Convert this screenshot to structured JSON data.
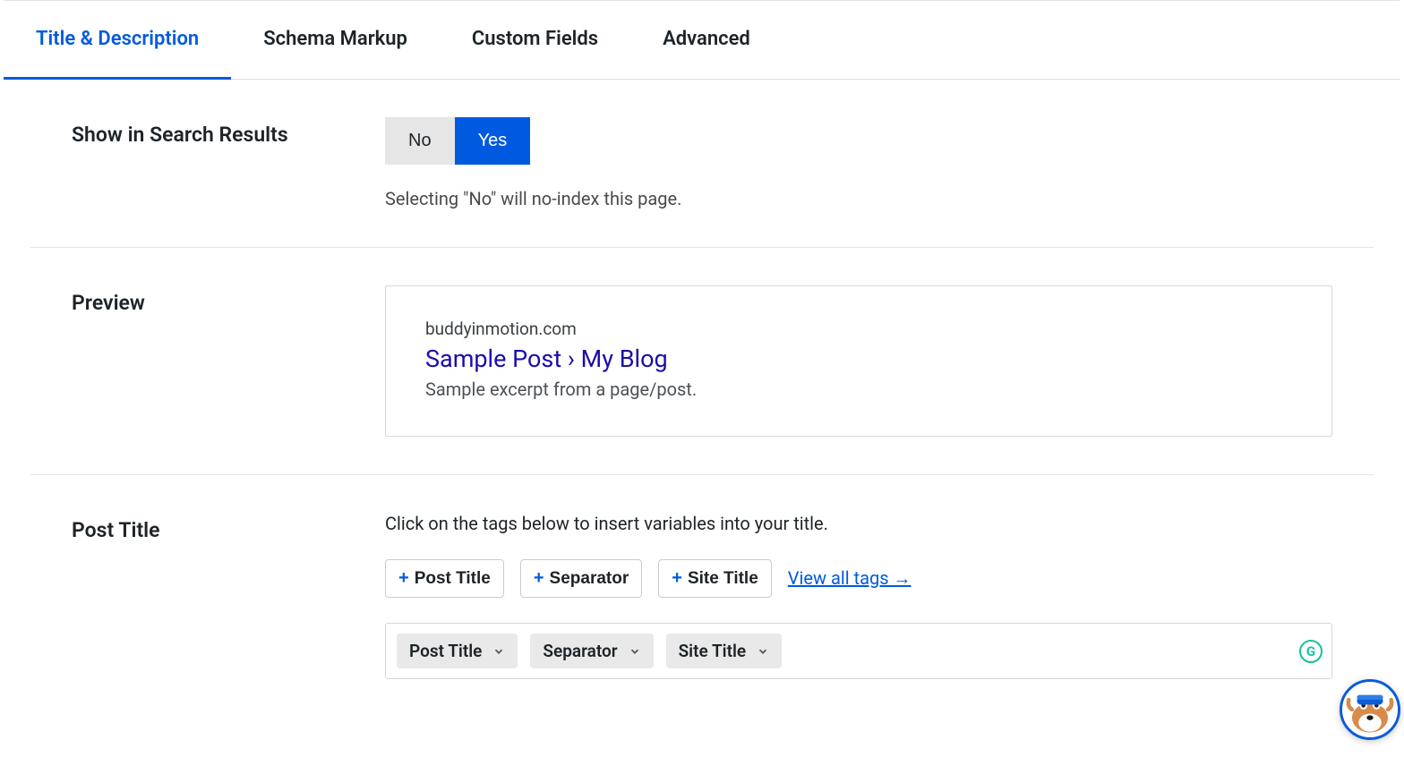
{
  "tabs": [
    {
      "label": "Title & Description",
      "active": true
    },
    {
      "label": "Schema Markup",
      "active": false
    },
    {
      "label": "Custom Fields",
      "active": false
    },
    {
      "label": "Advanced",
      "active": false
    }
  ],
  "sections": {
    "search": {
      "label": "Show in Search Results",
      "no": "No",
      "yes": "Yes",
      "hint": "Selecting \"No\" will no-index this page."
    },
    "preview": {
      "label": "Preview",
      "url": "buddyinmotion.com",
      "title": "Sample Post › My Blog",
      "desc": "Sample excerpt from a page/post."
    },
    "post_title": {
      "label": "Post Title",
      "hint": "Click on the tags below to insert variables into your title.",
      "tags": [
        {
          "text": "Post Title"
        },
        {
          "text": "Separator"
        },
        {
          "text": "Site Title"
        }
      ],
      "view_all": "View all tags →",
      "chips": [
        {
          "text": "Post Title"
        },
        {
          "text": "Separator"
        },
        {
          "text": "Site Title"
        }
      ]
    }
  }
}
